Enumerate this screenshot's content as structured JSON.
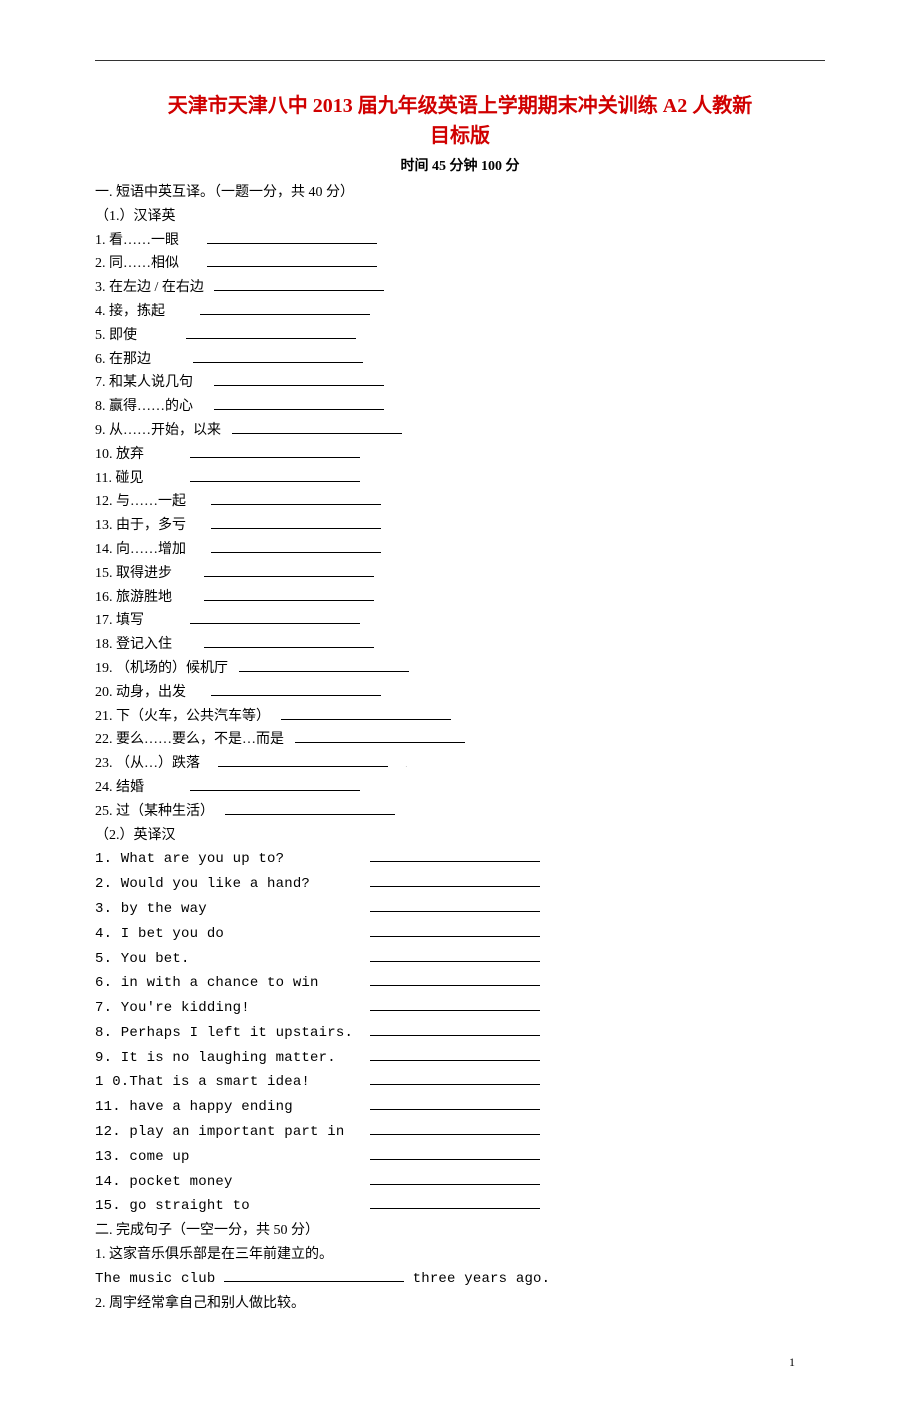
{
  "title_line1": "天津市天津八中 2013 届九年级英语上学期期末冲关训练 A2  人教新",
  "title_line2": "目标版",
  "subtitle": "时间 45 分钟  100 分",
  "section1_head": "一. 短语中英互译。（一题一分，共 40 分）",
  "part1_label": "（1.）汉译英",
  "cn_items": [
    {
      "n": "1.",
      "t": "看……一眼"
    },
    {
      "n": "2.",
      "t": "同……相似"
    },
    {
      "n": "3.",
      "t": "在左边 / 在右边"
    },
    {
      "n": "4.",
      "t": "接，拣起"
    },
    {
      "n": "5.",
      "t": "即使"
    },
    {
      "n": "6.",
      "t": "在那边"
    },
    {
      "n": "7.",
      "t": "和某人说几句"
    },
    {
      "n": "8.",
      "t": "赢得……的心"
    },
    {
      "n": "9.",
      "t": "从……开始，以来"
    },
    {
      "n": "10.",
      "t": "放弃"
    },
    {
      "n": "11.",
      "t": "碰见"
    },
    {
      "n": "12.",
      "t": "与……一起"
    },
    {
      "n": "13.",
      "t": "由于，多亏"
    },
    {
      "n": "14.",
      "t": "向……增加"
    },
    {
      "n": "15.",
      "t": "取得进步"
    },
    {
      "n": "16.",
      "t": "旅游胜地"
    },
    {
      "n": "17.",
      "t": "填写"
    },
    {
      "n": "18.",
      "t": "登记入住"
    },
    {
      "n": "19.",
      "t": "（机场的）候机厅"
    },
    {
      "n": "20.",
      "t": "动身，出发"
    },
    {
      "n": "21.",
      "t": "下（火车，公共汽车等）"
    },
    {
      "n": "22.",
      "t": "要么……要么，不是…而是"
    },
    {
      "n": "23.",
      "t": "（从…）跌落"
    },
    {
      "n": "24.",
      "t": "结婚"
    },
    {
      "n": "25.",
      "t": "过（某种生活）"
    }
  ],
  "part2_label": "（2.）英译汉",
  "en_items": [
    {
      "n": "1.",
      "t": " What are you up to?"
    },
    {
      "n": "2.",
      "t": " Would you like a hand?"
    },
    {
      "n": "3.",
      "t": " by the way"
    },
    {
      "n": "4.",
      "t": " I bet you do"
    },
    {
      "n": "5.",
      "t": " You bet."
    },
    {
      "n": "6.",
      "t": " in with a chance to win"
    },
    {
      "n": "7.",
      "t": " You're kidding!"
    },
    {
      "n": "8.",
      "t": " Perhaps I left it upstairs."
    },
    {
      "n": "9.",
      "t": " It is no laughing matter."
    },
    {
      "n": "1 0.",
      "t": "That is a smart idea!"
    },
    {
      "n": "11.",
      "t": " have a happy ending"
    },
    {
      "n": "12.",
      "t": " play an important part in"
    },
    {
      "n": "13.",
      "t": " come up"
    },
    {
      "n": "14.",
      "t": " pocket money"
    },
    {
      "n": "15.",
      "t": " go straight to"
    }
  ],
  "section2_head": "二. 完成句子（一空一分，共 50 分）",
  "s2_q1": "1. 这家音乐俱乐部是在三年前建立的。",
  "s2_q1_en_a": "The music club ",
  "s2_q1_en_b": " three years ago.",
  "s2_q2": "2. 周宇经常拿自己和别人做比较。",
  "page_number": "1"
}
